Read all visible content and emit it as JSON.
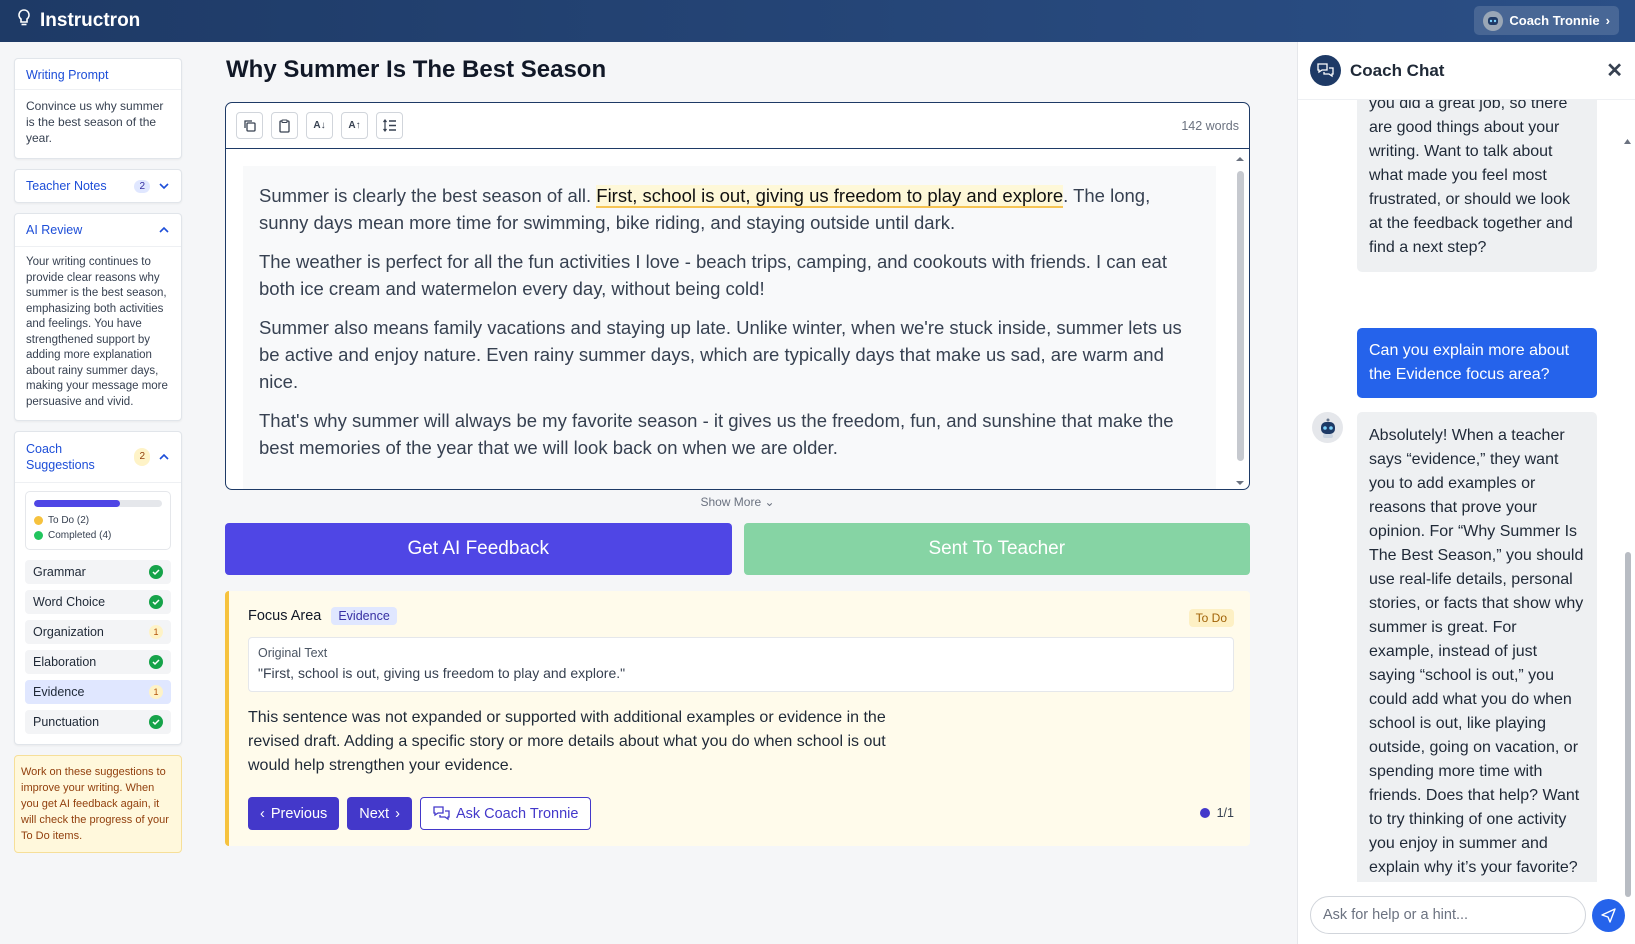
{
  "app": {
    "name": "Instructron",
    "coach_button": "Coach Tronnie"
  },
  "left": {
    "prompt": {
      "title": "Writing Prompt",
      "text": "Convince us why summer is the best season of the year."
    },
    "teacher_notes": {
      "title": "Teacher Notes",
      "count": "2"
    },
    "ai_review": {
      "title": "AI Review",
      "text": "Your writing continues to provide clear reasons why summer is the best season, emphasizing both activities and feelings. You have strengthened support by adding more explanation about rainy summer days, making your message more persuasive and vivid."
    },
    "coach": {
      "title": "Coach Suggestions",
      "count": "2",
      "progress": 0.67,
      "todo": "To Do (2)",
      "completed": "Completed (4)",
      "skills": [
        {
          "label": "Grammar",
          "status": "done"
        },
        {
          "label": "Word Choice",
          "status": "done"
        },
        {
          "label": "Organization",
          "status": "todo",
          "badge": "1"
        },
        {
          "label": "Elaboration",
          "status": "done"
        },
        {
          "label": "Evidence",
          "status": "todo",
          "badge": "1"
        },
        {
          "label": "Punctuation",
          "status": "done"
        }
      ]
    },
    "note": "Work on these suggestions to improve your writing. When you get AI feedback again, it will check the progress of your To Do items."
  },
  "main": {
    "title": "Why Summer Is The Best Season",
    "word_count": "142 words",
    "paragraphs": {
      "p1a": "Summer is clearly the best season of all. ",
      "p1hl": "First, school is out, giving us freedom to play and explore",
      "p1b": ". The long, sunny days mean more time for swimming, bike riding, and staying outside until dark.",
      "p2": "The weather is perfect for all the fun activities I love - beach trips, camping, and cookouts with friends. I can eat both ice cream and watermelon every day, without being cold!",
      "p3": "Summer also means family vacations and staying up late. Unlike winter, when we're stuck inside, summer lets us be active and enjoy nature. Even rainy summer days, which are typically days that make us sad, are warm and nice.",
      "p4": "That's why summer will always be my favorite season - it gives us the freedom, fun, and sunshine that make the best memories of the year that we will look back on when we are older."
    },
    "show_more": "Show More",
    "get_feedback": "Get AI Feedback",
    "sent_teacher": "Sent To Teacher",
    "focus": {
      "label": "Focus Area",
      "tag": "Evidence",
      "status": "To Do",
      "original_label": "Original Text",
      "original": "\"First, school is out, giving us freedom to play and explore.\"",
      "body": "This sentence was not expanded or supported with additional examples or evidence in the revised draft. Adding a specific story or more details about what you do when school is out would help strengthen your evidence.",
      "prev": "Previous",
      "next": "Next",
      "ask": "Ask Coach Tronnie",
      "page": "1/1"
    }
  },
  "chat": {
    "title": "Coach Chat",
    "msg1": "you did a great job, so there are good things about your writing. Want to talk about what made you feel most frustrated, or should we look at the feedback together and find a next step?",
    "msg2": "Can you explain more about the Evidence focus area?",
    "msg3": "Absolutely! When a teacher says “evidence,” they want you to add examples or reasons that prove your opinion. For “Why Summer Is The Best Season,” you should use real-life details, personal stories, or facts that show why summer is great. For example, instead of just saying “school is out,” you could add what you do when school is out, like playing outside, going on vacation, or spending more time with friends. Does that help? Want to try thinking of one activity you enjoy in summer and explain why it’s your favorite?",
    "placeholder": "Ask for help or a hint..."
  },
  "colors": {
    "primary": "#4f46e5",
    "sent": "#86d4a4",
    "topbar": "#1e3a66",
    "chat_user": "#2563eb"
  }
}
